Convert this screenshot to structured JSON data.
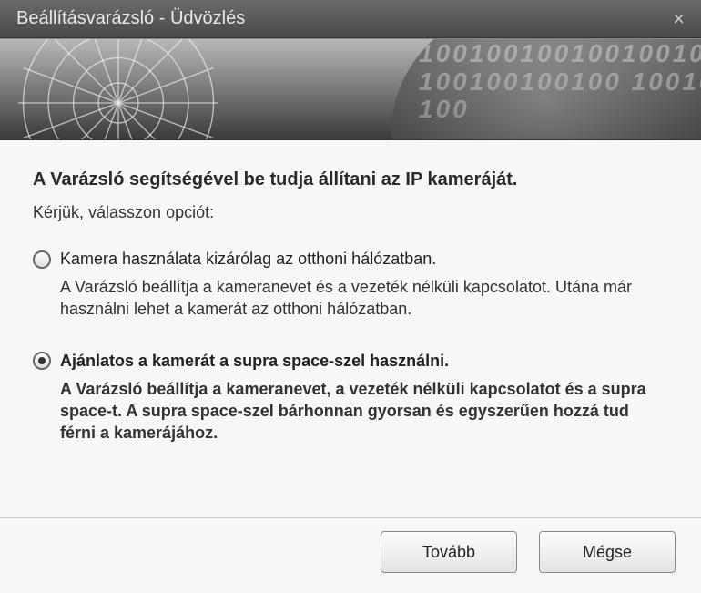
{
  "titlebar": {
    "title": "Beállításvarázsló - Üdvözlés"
  },
  "content": {
    "headline": "A Varázsló segítségével be tudja állítani az IP kameráját.",
    "instruction": "Kérjük, válasszon opciót:",
    "options": [
      {
        "label": "Kamera használata kizárólag az otthoni hálózatban.",
        "description": "A Varázsló beállítja a kameranevet és a vezeték nélküli kapcsolatot. Utána már használni lehet a kamerát az otthoni hálózatban.",
        "selected": false
      },
      {
        "label": "Ajánlatos a kamerát a supra space-szel használni.",
        "description": "A Varázsló beállítja a kameranevet, a vezeték nélküli kapcsolatot és a supra space-t. A supra space-szel bárhonnan gyorsan és egyszerűen hozzá tud férni a kamerájához.",
        "selected": true
      }
    ]
  },
  "buttons": {
    "next": "Tovább",
    "cancel": "Mégse"
  }
}
